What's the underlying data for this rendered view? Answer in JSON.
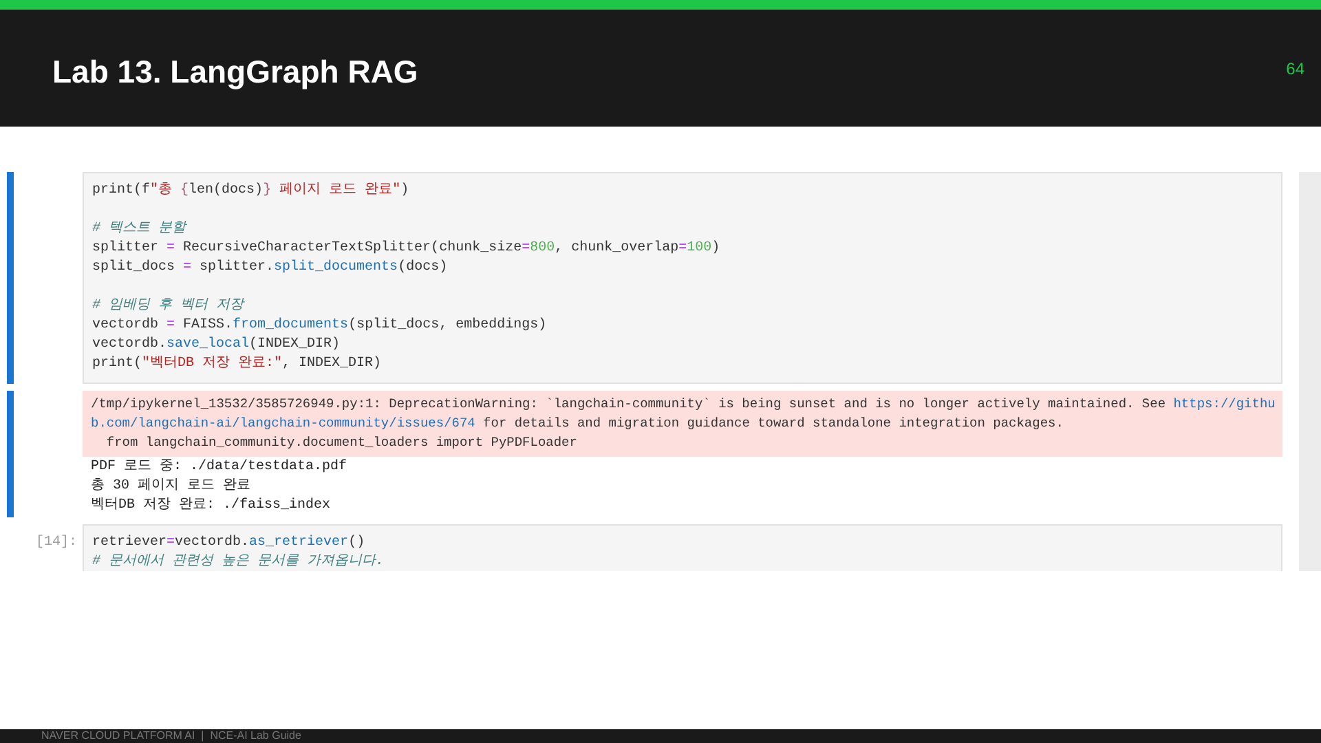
{
  "header": {
    "title": "Lab 13. LangGraph RAG",
    "page_number": "64"
  },
  "cells": [
    {
      "kind": "code",
      "active": true,
      "lines": [
        {
          "kind": "code",
          "segments": [
            {
              "kind": "name",
              "text": "print(f"
            },
            {
              "kind": "string",
              "text": "\"총 "
            },
            {
              "kind": "interp",
              "text": "{"
            },
            {
              "kind": "name",
              "text": "len(docs)"
            },
            {
              "kind": "interp",
              "text": "}"
            },
            {
              "kind": "string",
              "text": " 페이지 로드 완료\""
            },
            {
              "kind": "name",
              "text": ")"
            }
          ]
        },
        {
          "kind": "blank"
        },
        {
          "kind": "code",
          "segments": [
            {
              "kind": "comment",
              "text": "# 텍스트 분할"
            }
          ]
        },
        {
          "kind": "code",
          "segments": [
            {
              "kind": "name",
              "text": "splitter "
            },
            {
              "kind": "op",
              "text": "="
            },
            {
              "kind": "name",
              "text": " RecursiveCharacterTextSplitter(chunk_size"
            },
            {
              "kind": "op",
              "text": "="
            },
            {
              "kind": "number",
              "text": "800"
            },
            {
              "kind": "name",
              "text": ", chunk_overlap"
            },
            {
              "kind": "op",
              "text": "="
            },
            {
              "kind": "number",
              "text": "100"
            },
            {
              "kind": "name",
              "text": ")"
            }
          ]
        },
        {
          "kind": "code",
          "segments": [
            {
              "kind": "name",
              "text": "split_docs "
            },
            {
              "kind": "op",
              "text": "="
            },
            {
              "kind": "name",
              "text": " splitter."
            },
            {
              "kind": "func",
              "text": "split_documents"
            },
            {
              "kind": "name",
              "text": "(docs)"
            }
          ]
        },
        {
          "kind": "blank"
        },
        {
          "kind": "code",
          "segments": [
            {
              "kind": "comment",
              "text": "# 임베딩 후 벡터 저장"
            }
          ]
        },
        {
          "kind": "code",
          "segments": [
            {
              "kind": "name",
              "text": "vectordb "
            },
            {
              "kind": "op",
              "text": "="
            },
            {
              "kind": "name",
              "text": " FAISS."
            },
            {
              "kind": "func",
              "text": "from_documents"
            },
            {
              "kind": "name",
              "text": "(split_docs, embeddings)"
            }
          ]
        },
        {
          "kind": "code",
          "segments": [
            {
              "kind": "name",
              "text": "vectordb."
            },
            {
              "kind": "func",
              "text": "save_local"
            },
            {
              "kind": "name",
              "text": "(INDEX_DIR)"
            }
          ]
        },
        {
          "kind": "code",
          "segments": [
            {
              "kind": "name",
              "text": "print("
            },
            {
              "kind": "string",
              "text": "\"벡터DB 저장 완료:\""
            },
            {
              "kind": "name",
              "text": ", INDEX_DIR)"
            }
          ]
        }
      ]
    },
    {
      "kind": "output",
      "active": true,
      "warning": [
        {
          "kind": "code",
          "segments": [
            {
              "kind": "name",
              "text": "/tmp/ipykernel_13532/3585726949.py:1: DeprecationWarning: `langchain-community` is being sunset and is no longer actively maintained. See "
            },
            {
              "kind": "link",
              "text": "https://githu"
            }
          ]
        },
        {
          "kind": "code",
          "segments": [
            {
              "kind": "link",
              "text": "b.com/langchain-ai/langchain-community/issues/674"
            },
            {
              "kind": "name",
              "text": " for details and migration guidance toward standalone integration packages."
            }
          ]
        },
        {
          "kind": "code",
          "segments": [
            {
              "kind": "name",
              "text": "  from langchain_community.document_loaders import PyPDFLoader"
            }
          ]
        }
      ],
      "stdout": [
        "PDF 로드 중: ./data/testdata.pdf",
        "총 30 페이지 로드 완료",
        "벡터DB 저장 완료: ./faiss_index"
      ]
    },
    {
      "kind": "code",
      "prompt": "[14]:",
      "active": false,
      "lines": [
        {
          "kind": "code",
          "segments": [
            {
              "kind": "name",
              "text": "retriever"
            },
            {
              "kind": "op",
              "text": "="
            },
            {
              "kind": "name",
              "text": "vectordb."
            },
            {
              "kind": "func",
              "text": "as_retriever"
            },
            {
              "kind": "name",
              "text": "()"
            }
          ]
        },
        {
          "kind": "code",
          "segments": [
            {
              "kind": "comment",
              "text": "# 문서에서 관련성 높은 문서를 가져옵니다."
            }
          ]
        }
      ]
    }
  ],
  "footer": {
    "text": "NAVER CLOUD PLATFORM AI  |  NCE-AI Lab Guide"
  }
}
